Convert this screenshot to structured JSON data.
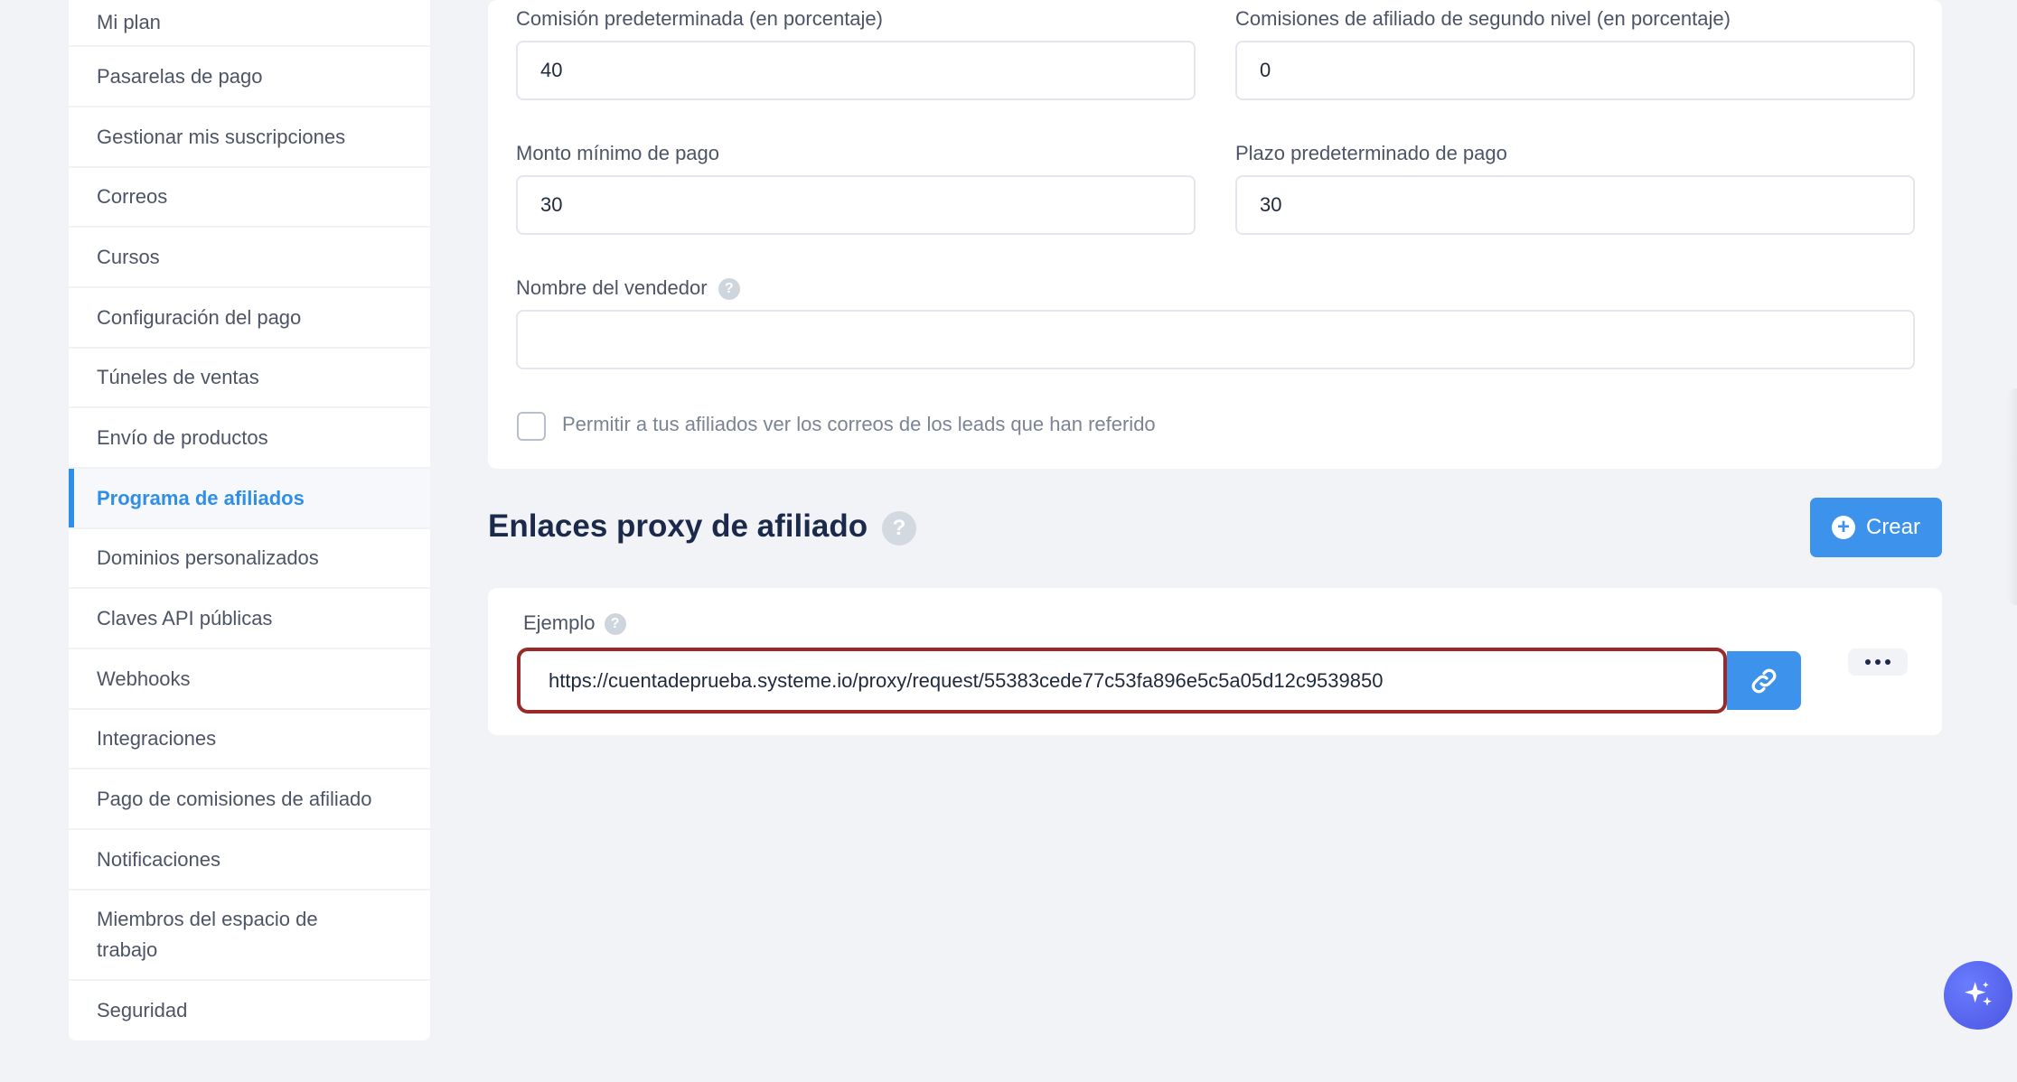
{
  "sidebar": {
    "items": [
      {
        "label": "Mi plan"
      },
      {
        "label": "Pasarelas de pago"
      },
      {
        "label": "Gestionar mis suscripciones"
      },
      {
        "label": "Correos"
      },
      {
        "label": "Cursos"
      },
      {
        "label": "Configuración del pago"
      },
      {
        "label": "Túneles de ventas"
      },
      {
        "label": "Envío de productos"
      },
      {
        "label": "Programa de afiliados"
      },
      {
        "label": "Dominios personalizados"
      },
      {
        "label": "Claves API públicas"
      },
      {
        "label": "Webhooks"
      },
      {
        "label": "Integraciones"
      },
      {
        "label": "Pago de comisiones de afiliado"
      },
      {
        "label": "Notificaciones"
      },
      {
        "label": "Miembros del espacio de trabajo"
      },
      {
        "label": "Seguridad"
      }
    ],
    "active_index": 8
  },
  "settings": {
    "default_commission": {
      "label": "Comisión predeterminada (en porcentaje)",
      "value": "40"
    },
    "second_level_commission": {
      "label": "Comisiones de afiliado de segundo nivel (en porcentaje)",
      "value": "0"
    },
    "min_payout": {
      "label": "Monto mínimo de pago",
      "value": "30"
    },
    "default_payout_term": {
      "label": "Plazo predeterminado de pago",
      "value": "30"
    },
    "seller_name": {
      "label": "Nombre del vendedor",
      "value": ""
    },
    "allow_see_emails": {
      "label": "Permitir a tus afiliados ver los correos de los leads que han referido",
      "checked": false
    }
  },
  "proxy_links": {
    "title": "Enlaces proxy de afiliado",
    "create_label": "Crear",
    "entry": {
      "label": "Ejemplo",
      "url": "https://cuentadeprueba.systeme.io/proxy/request/55383cede77c53fa896e5c5a05d12c9539850"
    }
  },
  "icons": {
    "help": "?",
    "link": "link-icon",
    "more": "more-dots-icon",
    "ai": "sparkles-icon",
    "plus": "+"
  },
  "colors": {
    "accent": "#3d93ec",
    "highlight_border": "#9a2a2a",
    "title": "#1b2a4a"
  }
}
